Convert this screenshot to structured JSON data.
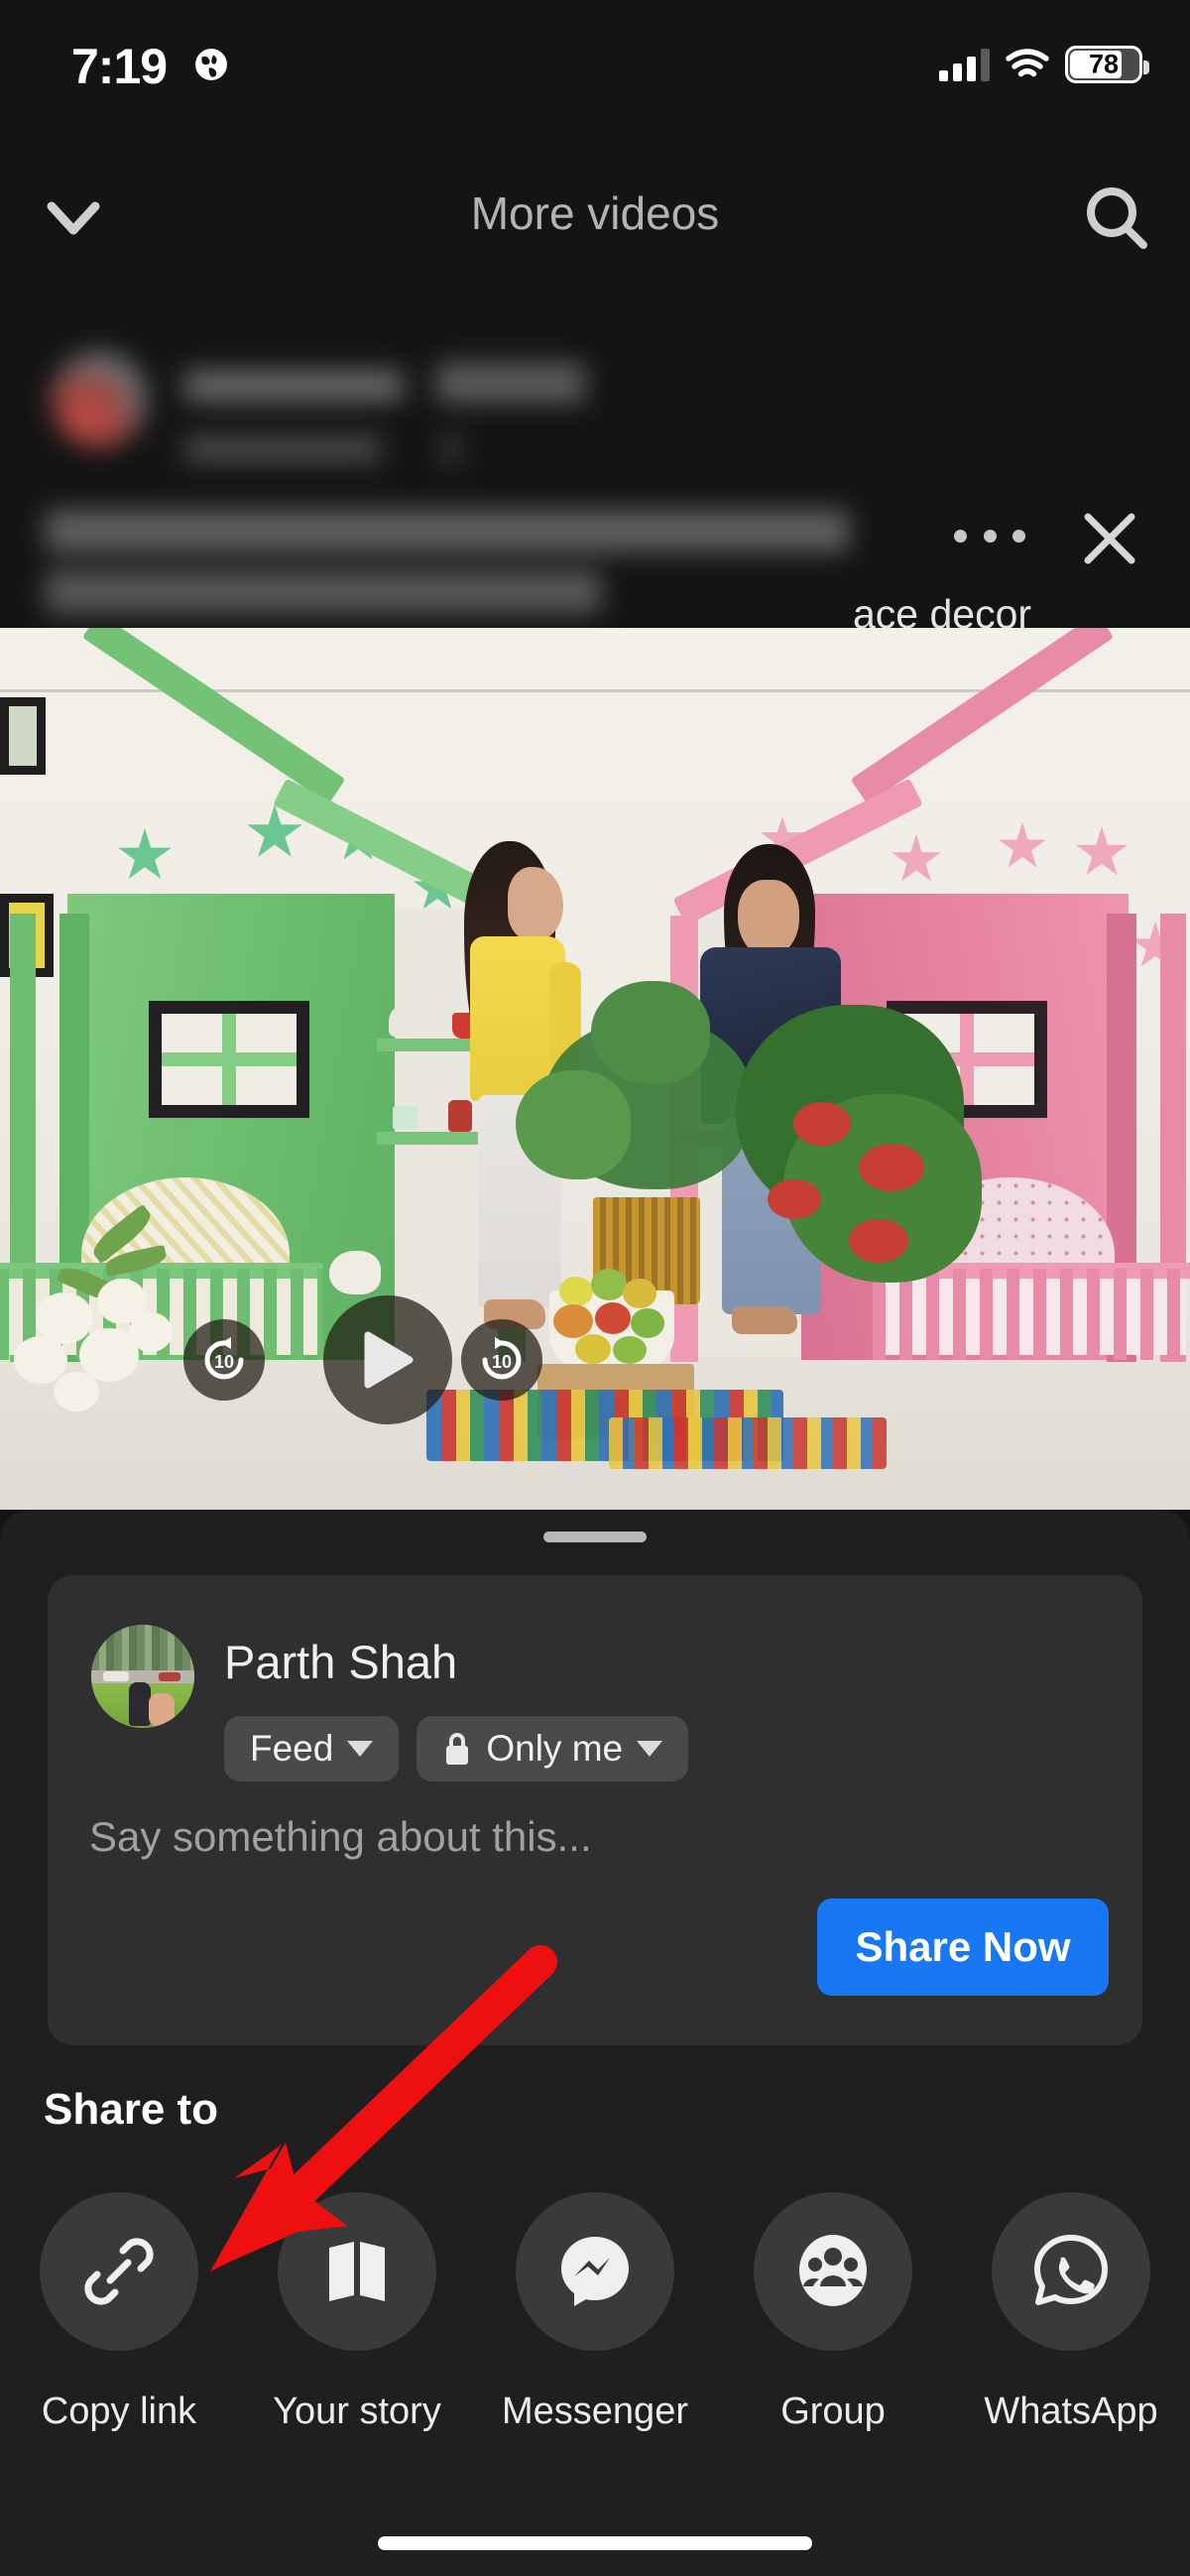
{
  "status_bar": {
    "time": "7:19",
    "globe_icon": "globe-icon",
    "signal_icon": "cellular-signal-icon",
    "wifi_icon": "wifi-icon",
    "battery_percent": "78",
    "battery_icon": "battery-icon"
  },
  "nav_bar": {
    "title": "More videos",
    "collapse_icon": "chevron-down-icon",
    "search_icon": "search-icon"
  },
  "post_header": {
    "caption_visible_fragment": "ace decor",
    "more_options_icon": "ellipsis-icon",
    "close_icon": "close-icon",
    "author_blurred": true,
    "follow_button_blurred": true
  },
  "video": {
    "play_icon": "play-icon",
    "rewind_label": "10",
    "rewind_icon": "rewind-10-icon",
    "forward_label": "10",
    "forward_icon": "forward-10-icon"
  },
  "share_sheet": {
    "grabber": "sheet-drag-handle",
    "compose": {
      "user_name": "Parth Shah",
      "avatar": "user-avatar",
      "destination": "Feed",
      "destination_caret": "chevron-down-icon",
      "privacy": "Only me",
      "privacy_icon": "lock-icon",
      "privacy_caret": "chevron-down-icon",
      "placeholder": "Say something about this...",
      "share_button": "Share Now",
      "share_button_color": "#1877f2"
    },
    "share_to_label": "Share to",
    "targets": [
      {
        "label": "Copy link",
        "icon": "link-icon"
      },
      {
        "label": "Your story",
        "icon": "book-icon"
      },
      {
        "label": "Messenger",
        "icon": "messenger-icon"
      },
      {
        "label": "Group",
        "icon": "people-group-icon"
      },
      {
        "label": "WhatsApp",
        "icon": "whatsapp-icon"
      }
    ]
  },
  "annotation": {
    "arrow_color": "#ee1010",
    "arrow_points_to": "Copy link"
  },
  "home_indicator": "home-indicator"
}
